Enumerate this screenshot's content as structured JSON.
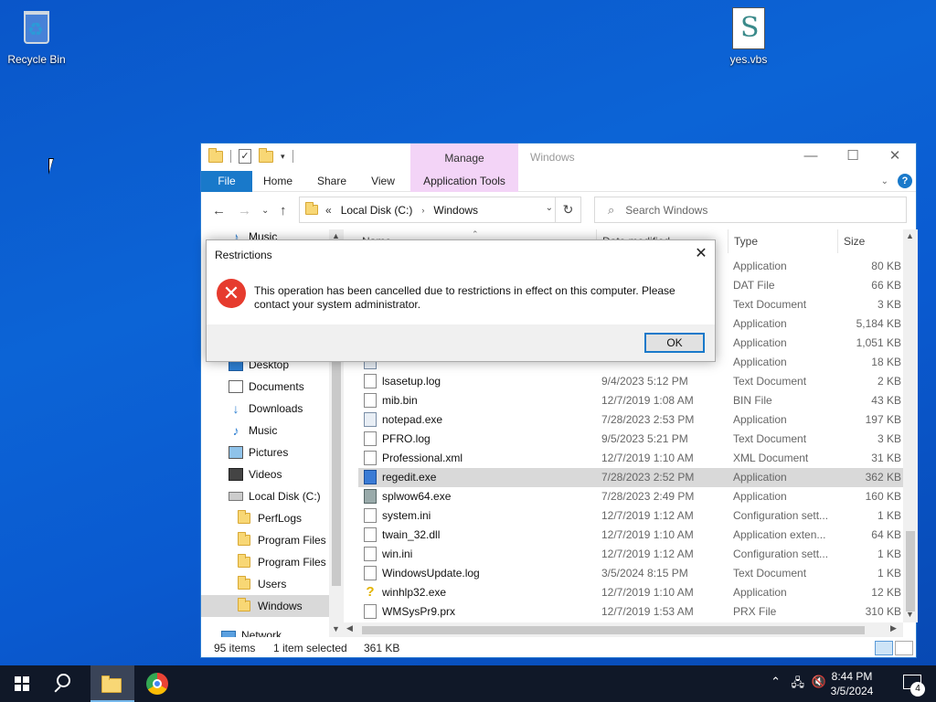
{
  "desktop": {
    "icons": [
      {
        "label": "Recycle Bin",
        "icon": "recycle-bin-icon"
      },
      {
        "label": "yes.vbs",
        "icon": "vbs-script-icon"
      }
    ]
  },
  "explorer": {
    "title": "Windows",
    "contextual_tab_group": "Manage",
    "ribbon_tabs": [
      "File",
      "Home",
      "Share",
      "View",
      "Application Tools"
    ],
    "address": {
      "prefix": "«",
      "crumbs": [
        "Local Disk (C:)",
        "Windows"
      ]
    },
    "search_placeholder": "Search Windows",
    "columns": {
      "name": "Name",
      "date": "Date modified",
      "type": "Type",
      "size": "Size"
    },
    "nav_items": [
      {
        "label": "Music",
        "icon": "music-icon"
      },
      {
        "label": "Desktop",
        "icon": "desktop-icon"
      },
      {
        "label": "Documents",
        "icon": "documents-icon"
      },
      {
        "label": "Downloads",
        "icon": "downloads-icon"
      },
      {
        "label": "Music",
        "icon": "music-icon"
      },
      {
        "label": "Pictures",
        "icon": "pictures-icon"
      },
      {
        "label": "Videos",
        "icon": "videos-icon"
      },
      {
        "label": "Local Disk (C:)",
        "icon": "disk-icon"
      },
      {
        "label": "PerfLogs",
        "icon": "folder-icon"
      },
      {
        "label": "Program Files",
        "icon": "folder-icon"
      },
      {
        "label": "Program Files (",
        "icon": "folder-icon"
      },
      {
        "label": "Users",
        "icon": "folder-icon"
      },
      {
        "label": "Windows",
        "icon": "folder-icon",
        "selected": true
      },
      {
        "label": "Network",
        "icon": "network-icon"
      }
    ],
    "files": [
      {
        "name": "",
        "date": "",
        "type": "Application",
        "size": "80 KB",
        "icon": "exe"
      },
      {
        "name": "",
        "date": "",
        "type": "DAT File",
        "size": "66 KB",
        "icon": "doc"
      },
      {
        "name": "",
        "date": "",
        "type": "Text Document",
        "size": "3 KB",
        "icon": "doc"
      },
      {
        "name": "",
        "date": "",
        "type": "Application",
        "size": "5,184 KB",
        "icon": "exe"
      },
      {
        "name": "",
        "date": "",
        "type": "Application",
        "size": "1,051 KB",
        "icon": "exe"
      },
      {
        "name": "",
        "date": "",
        "type": "Application",
        "size": "18 KB",
        "icon": "exe"
      },
      {
        "name": "lsasetup.log",
        "date": "9/4/2023 5:12 PM",
        "type": "Text Document",
        "size": "2 KB",
        "icon": "log"
      },
      {
        "name": "mib.bin",
        "date": "12/7/2019 1:08 AM",
        "type": "BIN File",
        "size": "43 KB",
        "icon": "doc"
      },
      {
        "name": "notepad.exe",
        "date": "7/28/2023 2:53 PM",
        "type": "Application",
        "size": "197 KB",
        "icon": "exe"
      },
      {
        "name": "PFRO.log",
        "date": "9/5/2023 5:21 PM",
        "type": "Text Document",
        "size": "3 KB",
        "icon": "log"
      },
      {
        "name": "Professional.xml",
        "date": "12/7/2019 1:10 AM",
        "type": "XML Document",
        "size": "31 KB",
        "icon": "doc"
      },
      {
        "name": "regedit.exe",
        "date": "7/28/2023 2:52 PM",
        "type": "Application",
        "size": "362 KB",
        "icon": "reg",
        "selected": true
      },
      {
        "name": "splwow64.exe",
        "date": "7/28/2023 2:49 PM",
        "type": "Application",
        "size": "160 KB",
        "icon": "print"
      },
      {
        "name": "system.ini",
        "date": "12/7/2019 1:12 AM",
        "type": "Configuration sett...",
        "size": "1 KB",
        "icon": "doc"
      },
      {
        "name": "twain_32.dll",
        "date": "12/7/2019 1:10 AM",
        "type": "Application exten...",
        "size": "64 KB",
        "icon": "doc"
      },
      {
        "name": "win.ini",
        "date": "12/7/2019 1:12 AM",
        "type": "Configuration sett...",
        "size": "1 KB",
        "icon": "doc"
      },
      {
        "name": "WindowsUpdate.log",
        "date": "3/5/2024 8:15 PM",
        "type": "Text Document",
        "size": "1 KB",
        "icon": "log"
      },
      {
        "name": "winhlp32.exe",
        "date": "12/7/2019 1:10 AM",
        "type": "Application",
        "size": "12 KB",
        "icon": "help"
      },
      {
        "name": "WMSysPr9.prx",
        "date": "12/7/2019 1:53 AM",
        "type": "PRX File",
        "size": "310 KB",
        "icon": "doc"
      }
    ],
    "status": {
      "items": "95 items",
      "selected": "1 item selected",
      "size": "361 KB"
    }
  },
  "dialog": {
    "title": "Restrictions",
    "message": "This operation has been cancelled due to restrictions in effect on this computer. Please contact your system administrator.",
    "ok_label": "OK"
  },
  "taskbar": {
    "time": "8:44 PM",
    "date": "3/5/2024",
    "notifications": "4"
  }
}
